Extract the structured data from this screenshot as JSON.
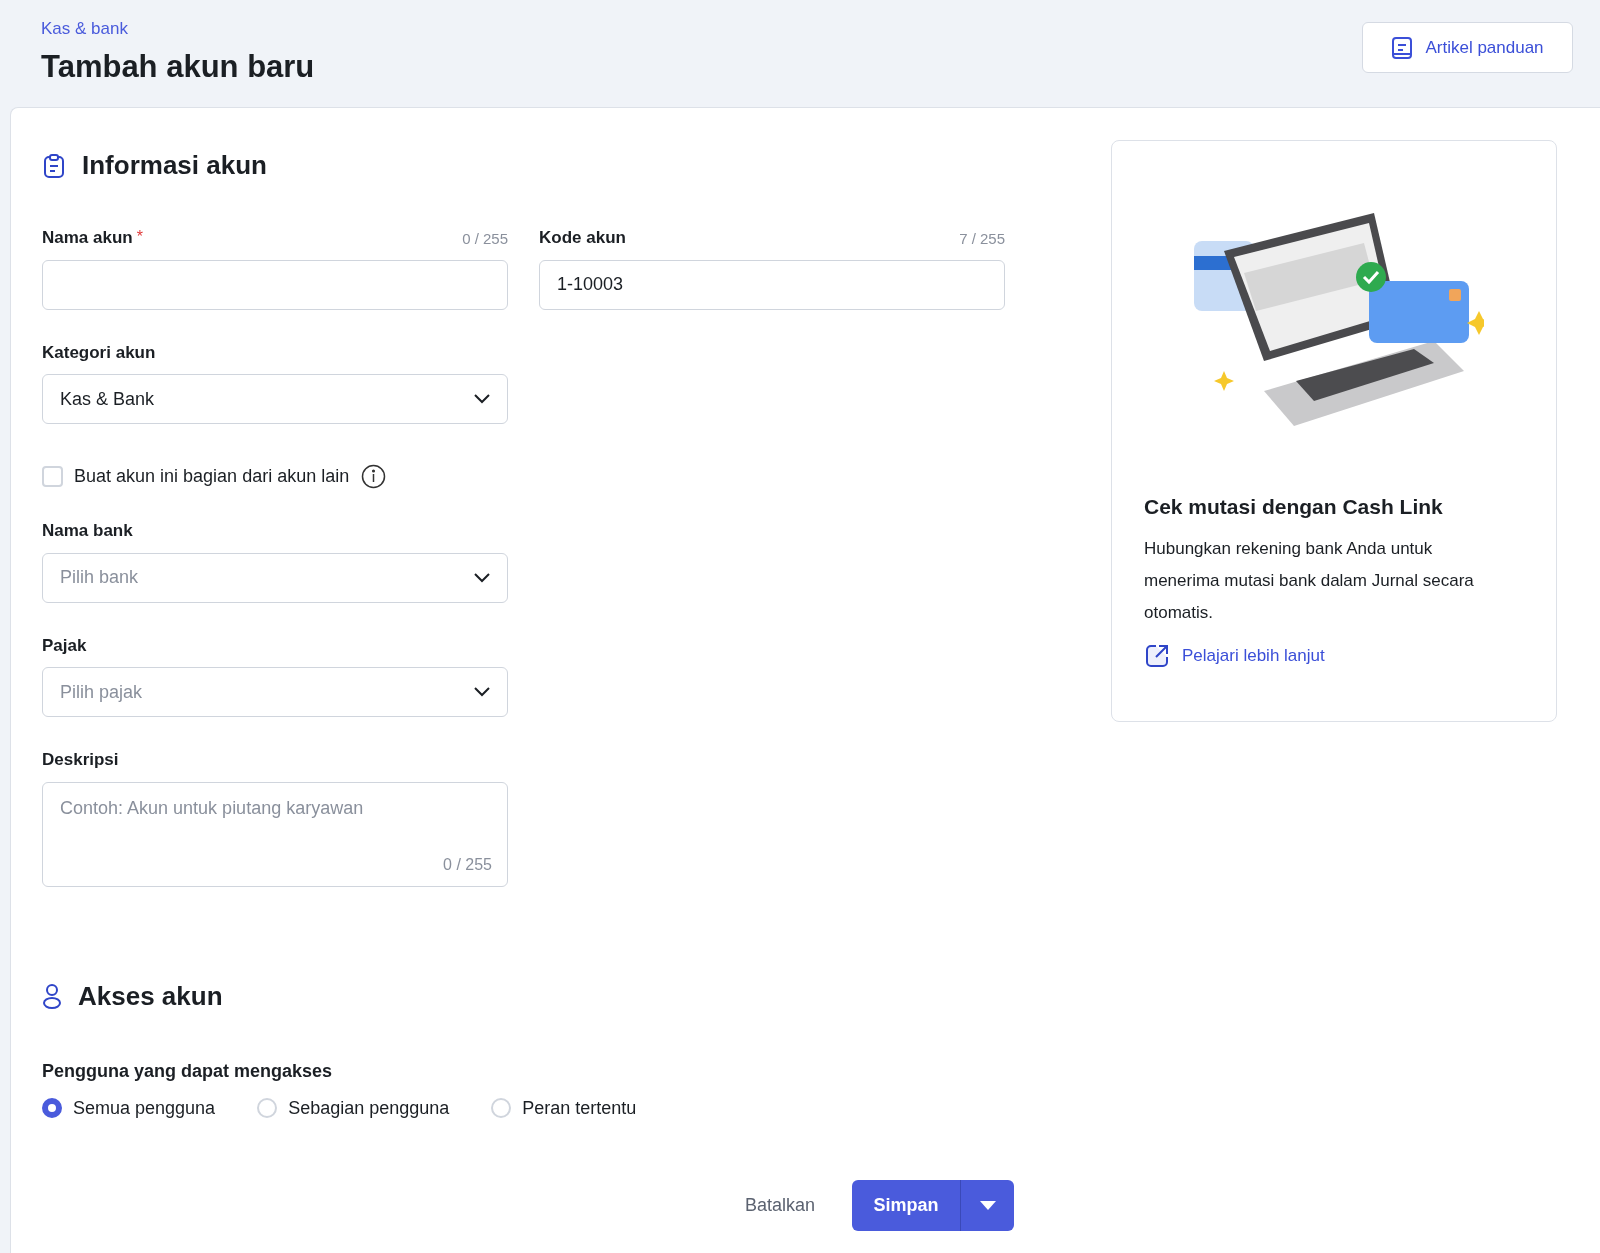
{
  "header": {
    "breadcrumb": "Kas & bank",
    "title": "Tambah akun baru",
    "guide_button": "Artikel panduan"
  },
  "account_info": {
    "title": "Informasi akun",
    "top_row": [
      {
        "label": "Nama akun",
        "required_mark": "*",
        "counter": "0 / 255"
      },
      {
        "label": "Kode akun",
        "counter": "7 / 255",
        "value": "1-10003"
      }
    ],
    "fields": [
      {
        "kind": "select",
        "label": "Kategori akun",
        "value": "Kas & Bank"
      },
      {
        "kind": "checkbox",
        "label": "Buat akun ini bagian dari akun lain",
        "checked": false
      },
      {
        "kind": "select",
        "label": "Nama bank",
        "placeholder": "Pilih bank"
      },
      {
        "kind": "select",
        "label": "Pajak",
        "placeholder": "Pilih pajak"
      },
      {
        "kind": "textarea",
        "label": "Deskripsi",
        "placeholder": "Contoh: Akun untuk piutang karyawan",
        "counter": "0 / 255"
      }
    ]
  },
  "access": {
    "title": "Akses akun",
    "label": "Pengguna yang dapat mengakses",
    "options": [
      {
        "label": "Semua pengguna",
        "selected": true
      },
      {
        "label": "Sebagian pengguna",
        "selected": false
      },
      {
        "label": "Peran tertentu",
        "selected": false
      }
    ]
  },
  "actions": {
    "cancel": "Batalkan",
    "save": "Simpan"
  },
  "promo": {
    "title": "Cek mutasi dengan Cash Link",
    "text": "Hubungkan rekening bank Anda untuk menerima mutasi bank dalam Jurnal secara otomatis.",
    "link": "Pelajari lebih lanjut"
  }
}
